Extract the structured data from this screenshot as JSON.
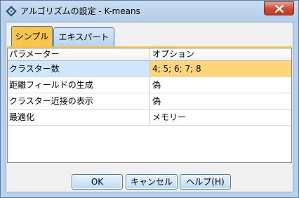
{
  "window": {
    "title": "アルゴリズムの設定 - K-means"
  },
  "tabs": [
    {
      "label": "シンプル",
      "active": true
    },
    {
      "label": "エキスパート",
      "active": false
    }
  ],
  "table": {
    "headers": [
      "パラメーター",
      "オプション"
    ],
    "rows": [
      {
        "param": "クラスター数",
        "option": "4; 5; 6; 7; 8"
      },
      {
        "param": "距離フィールドの生成",
        "option": "偽"
      },
      {
        "param": "クラスター近接の表示",
        "option": "偽"
      },
      {
        "param": "最適化",
        "option": "メモリー"
      }
    ]
  },
  "buttons": {
    "ok": "OK",
    "cancel": "キャンセル",
    "help": "ヘルプ(H)"
  },
  "colors": {
    "active_tab": "#f7c64a",
    "selected_option_cell": "#fdd67a",
    "selected_param_cell": "#cfe6ff",
    "close_button": "#c74a33"
  }
}
